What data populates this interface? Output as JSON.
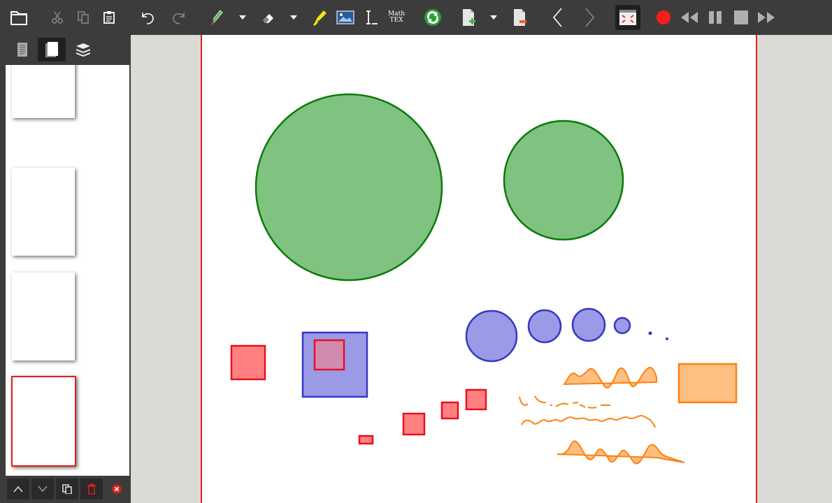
{
  "toolbar": {
    "math_label_line1": "Math",
    "math_label_line2": "TEX",
    "tools": [
      "open-icon",
      "cut-icon",
      "copy-icon",
      "paste-icon",
      "undo-icon",
      "redo-icon",
      "pen-icon",
      "pen-dropdown-icon",
      "eraser-icon",
      "eraser-dropdown-icon",
      "highlighter-icon",
      "image-icon",
      "text-cursor-icon",
      "math-tex-icon",
      "refresh-icon",
      "new-page-icon",
      "new-page-dropdown-icon",
      "delete-page-icon",
      "previous-page-icon",
      "next-page-icon",
      "fullscreen-icon",
      "record-icon",
      "rewind-icon",
      "pause-icon",
      "stop-icon",
      "fast-forward-icon"
    ]
  },
  "sidebar": {
    "tabs": [
      "single-page-view-icon",
      "page-thumbnails-icon",
      "layers-icon"
    ],
    "active_tab": 1,
    "page_count": 4,
    "current_page": 4,
    "bottom_buttons": [
      "move-up-icon",
      "move-down-icon",
      "duplicate-page-icon",
      "delete-page-icon",
      "close-icon"
    ]
  },
  "colors": {
    "toolbar_bg": "#3c3c3c",
    "page_border": "#e0201a",
    "green_fill": "#80c280",
    "green_stroke": "#0a7a0a",
    "blue_fill": "#9a9ae6",
    "blue_stroke": "#3636c4",
    "red_fill": "#ff8080",
    "red_stroke": "#e8101e",
    "orange_fill": "#ffbf80",
    "orange_stroke": "#ff8010",
    "record": "#ff1a1a"
  }
}
